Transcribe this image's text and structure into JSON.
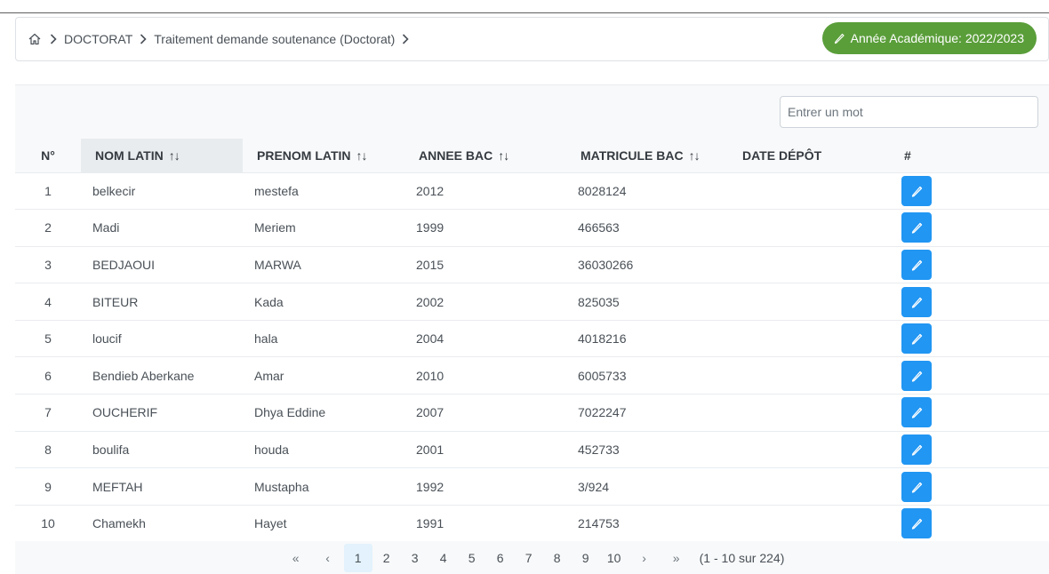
{
  "breadcrumb": {
    "items": [
      {
        "label": "DOCTORAT"
      },
      {
        "label": "Traitement demande soutenance (Doctorat)"
      }
    ]
  },
  "year_badge": {
    "label": "Année Académique: 2022/2023"
  },
  "search": {
    "placeholder": "Entrer un mot"
  },
  "table": {
    "columns": [
      "N°",
      "NOM LATIN",
      "PRENOM LATIN",
      "ANNEE BAC",
      "MATRICULE BAC",
      "DATE DÉPÔT",
      "#"
    ],
    "sort_glyph": "↑↓",
    "rows": [
      {
        "n": "1",
        "nom": "belkecir",
        "prenom": "mestefa",
        "annee": "2012",
        "matricule": "8028124",
        "date": ""
      },
      {
        "n": "2",
        "nom": "Madi",
        "prenom": "Meriem",
        "annee": "1999",
        "matricule": "466563",
        "date": ""
      },
      {
        "n": "3",
        "nom": "BEDJAOUI",
        "prenom": "MARWA",
        "annee": "2015",
        "matricule": "36030266",
        "date": ""
      },
      {
        "n": "4",
        "nom": "BITEUR",
        "prenom": "Kada",
        "annee": "2002",
        "matricule": "825035",
        "date": ""
      },
      {
        "n": "5",
        "nom": "loucif",
        "prenom": "hala",
        "annee": "2004",
        "matricule": "4018216",
        "date": ""
      },
      {
        "n": "6",
        "nom": "Bendieb Aberkane",
        "prenom": "Amar",
        "annee": "2010",
        "matricule": "6005733",
        "date": ""
      },
      {
        "n": "7",
        "nom": "OUCHERIF",
        "prenom": "Dhya Eddine",
        "annee": "2007",
        "matricule": "7022247",
        "date": ""
      },
      {
        "n": "8",
        "nom": "boulifa",
        "prenom": "houda",
        "annee": "2001",
        "matricule": "452733",
        "date": ""
      },
      {
        "n": "9",
        "nom": "MEFTAH",
        "prenom": "Mustapha",
        "annee": "1992",
        "matricule": "3/924",
        "date": ""
      },
      {
        "n": "10",
        "nom": "Chamekh",
        "prenom": "Hayet",
        "annee": "1991",
        "matricule": "214753",
        "date": ""
      }
    ]
  },
  "paginator": {
    "first": "«",
    "prev": "‹",
    "pages": [
      "1",
      "2",
      "3",
      "4",
      "5",
      "6",
      "7",
      "8",
      "9",
      "10"
    ],
    "current_page": "1",
    "next": "›",
    "last": "»",
    "report": "(1 - 10 sur 224)"
  },
  "colors": {
    "badge": "#5a9e3a",
    "edit_button": "#2196f3",
    "active_page": "#e3f2fd"
  },
  "icons": {
    "home": "home-icon",
    "separator": "chevron-right-icon",
    "badge": "pencil-icon",
    "edit": "pencil-icon"
  }
}
